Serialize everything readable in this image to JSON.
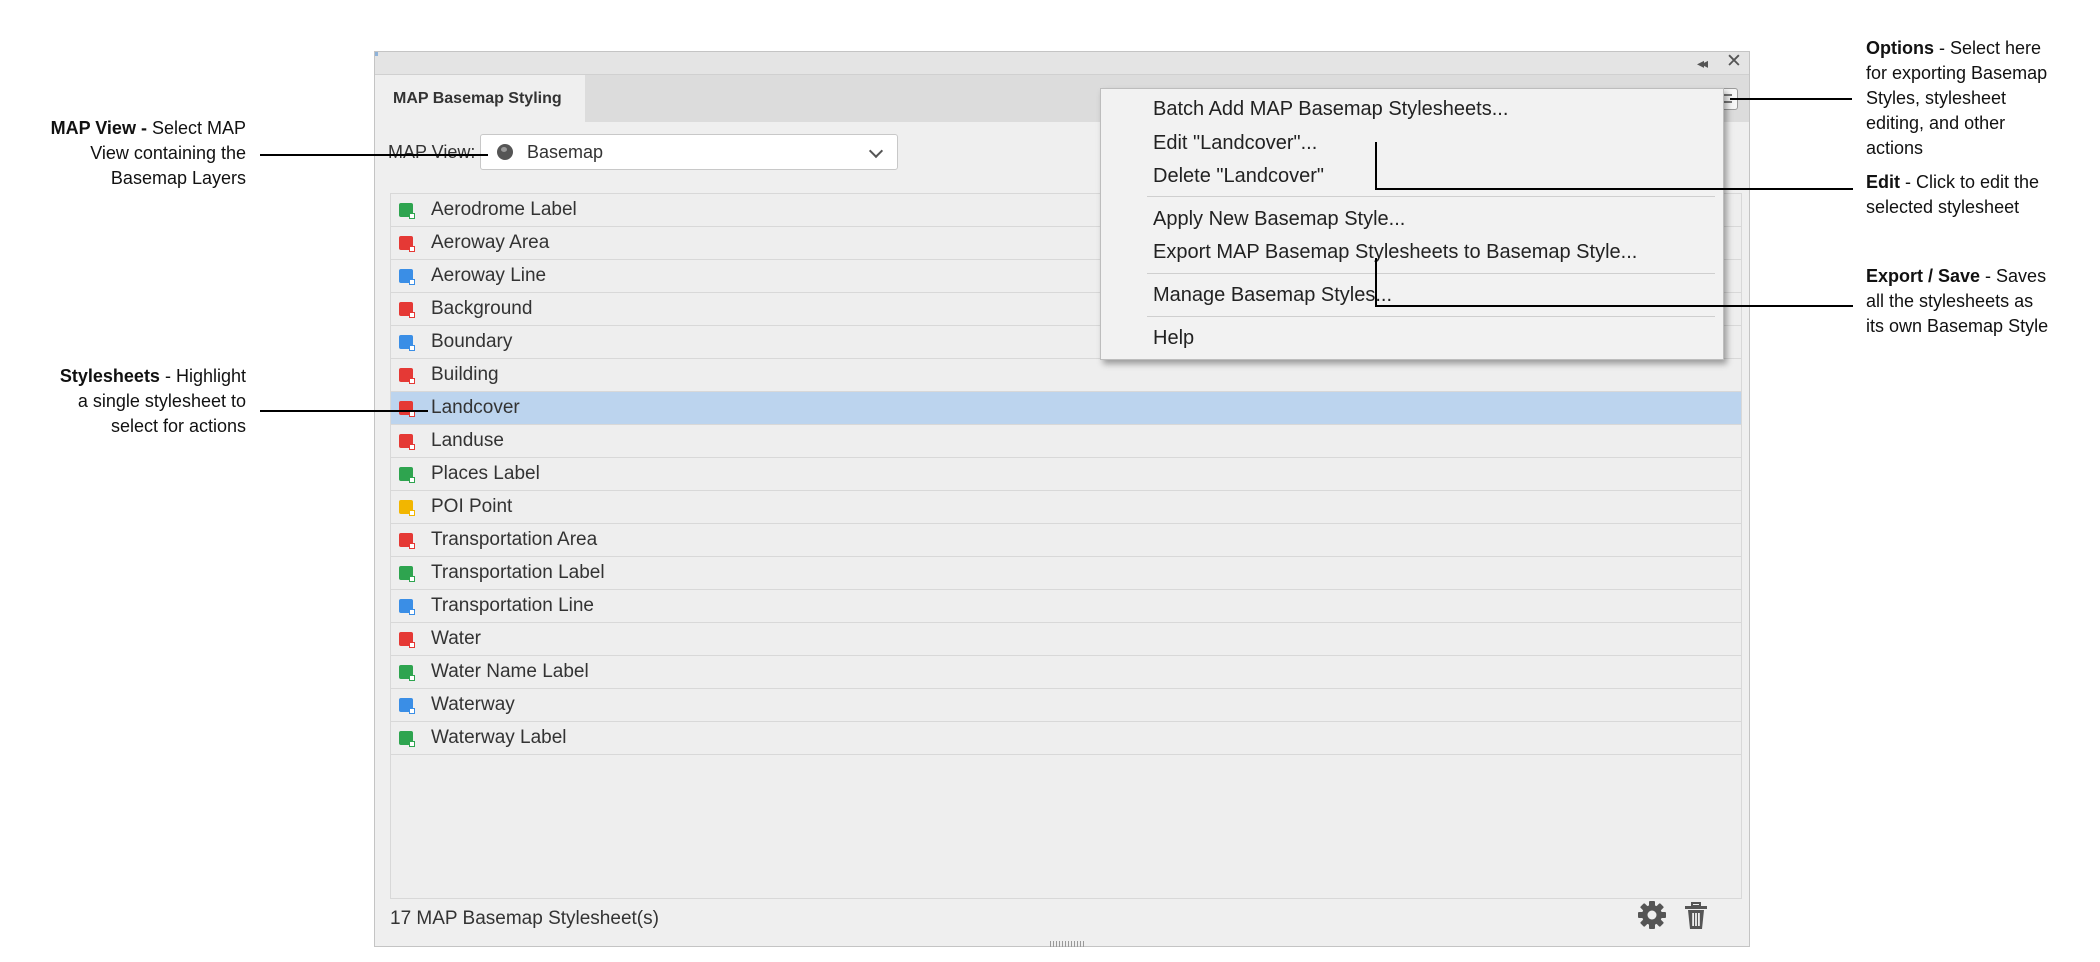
{
  "panel": {
    "tab_title": "MAP Basemap Styling",
    "view_label": "MAP View:",
    "view_value": "Basemap",
    "footer_count": "17 MAP Basemap Stylesheet(s)"
  },
  "stylesheets": [
    {
      "label": "Aerodrome Label",
      "color": "#2ea44f"
    },
    {
      "label": "Aeroway Area",
      "color": "#e53935"
    },
    {
      "label": "Aeroway Line",
      "color": "#3a8ee6"
    },
    {
      "label": "Background",
      "color": "#e53935"
    },
    {
      "label": "Boundary",
      "color": "#3a8ee6"
    },
    {
      "label": "Building",
      "color": "#e53935"
    },
    {
      "label": "Landcover",
      "color": "#e53935",
      "selected": true
    },
    {
      "label": "Landuse",
      "color": "#e53935"
    },
    {
      "label": "Places Label",
      "color": "#2ea44f"
    },
    {
      "label": "POI Point",
      "color": "#f2b600"
    },
    {
      "label": "Transportation Area",
      "color": "#e53935"
    },
    {
      "label": "Transportation Label",
      "color": "#2ea44f"
    },
    {
      "label": "Transportation Line",
      "color": "#3a8ee6"
    },
    {
      "label": "Water",
      "color": "#e53935"
    },
    {
      "label": "Water Name Label",
      "color": "#2ea44f"
    },
    {
      "label": "Waterway",
      "color": "#3a8ee6"
    },
    {
      "label": "Waterway Label",
      "color": "#2ea44f"
    }
  ],
  "menu": {
    "batch_add": "Batch Add MAP Basemap Stylesheets...",
    "edit": "Edit \"Landcover\"...",
    "delete": "Delete \"Landcover\"",
    "apply_new": "Apply New Basemap Style...",
    "export": "Export MAP Basemap Stylesheets to Basemap Style...",
    "manage": "Manage Basemap Styles...",
    "help": "Help"
  },
  "annotations": {
    "map_view": {
      "title": "MAP View -",
      "line1": " Select MAP",
      "line2": "View containing the",
      "line3": "Basemap Layers"
    },
    "stylesheets": {
      "title": "Stylesheets",
      "line1": " -  Highlight",
      "line2": "a single stylesheet to",
      "line3": "select for actions"
    },
    "options": {
      "title": "Options",
      "line1": " -  Select here",
      "line2": "for exporting Basemap",
      "line3": "Styles, stylesheet",
      "line4": "editing, and other",
      "line5": "actions"
    },
    "edit": {
      "title": "Edit",
      "line1": " - Click to edit the",
      "line2": "selected stylesheet"
    },
    "export": {
      "title": "Export / Save",
      "line1": " - Saves",
      "line2": "all the stylesheets as",
      "line3": "its own Basemap Style"
    }
  },
  "icons": {
    "collapse": "double-chevron-left-icon",
    "close": "close-icon",
    "options": "hamburger-menu-icon",
    "view": "globe-icon",
    "gear": "gear-icon",
    "trash": "trash-icon"
  }
}
